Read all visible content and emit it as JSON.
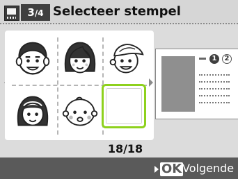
{
  "header": {
    "step_current": "3",
    "step_total": "4",
    "title": "Selecteer stempel"
  },
  "stamps": [
    {
      "name": "boy-face-icon"
    },
    {
      "name": "woman-face-icon"
    },
    {
      "name": "child-cap-face-icon"
    },
    {
      "name": "girl-face-icon"
    },
    {
      "name": "baby-face-icon"
    },
    {
      "name": "blank-stamp"
    }
  ],
  "counter": "18/18",
  "preview": {
    "badge1": "1",
    "badge2": "2"
  },
  "footer": {
    "ok_label": "OK",
    "next_label": "Volgende"
  },
  "colors": {
    "accent": "#8ed11d",
    "footer": "#5a5a5a"
  }
}
